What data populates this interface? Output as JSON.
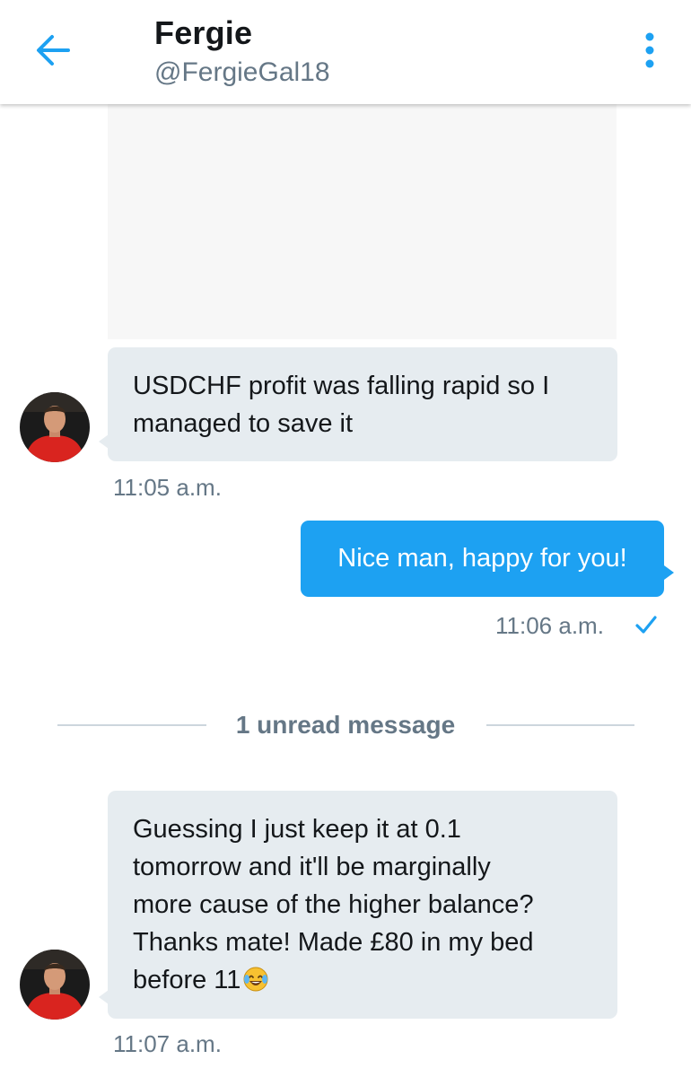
{
  "header": {
    "title": "Fergie",
    "handle": "@FergieGal18"
  },
  "messages": [
    {
      "direction": "incoming",
      "text": "USDCHF profit was falling rapid so I managed to save it",
      "time": "11:05 a.m."
    },
    {
      "direction": "outgoing",
      "text": "Nice man, happy for you!",
      "time": "11:06 a.m.",
      "status": "sent-checkmark"
    },
    {
      "direction": "incoming",
      "lines": [
        "Guessing I just keep it at 0.1",
        "tomorrow and it'll be marginally",
        "more cause of the higher balance?",
        "Thanks mate! Made £80 in my bed",
        "before 11"
      ],
      "emoji": "face-with-tears-of-joy",
      "time": "11:07 a.m."
    }
  ],
  "unread_divider": "1 unread message",
  "colors": {
    "accent": "#1da1f2",
    "incoming_bubble": "#e6ecf0",
    "secondary_text": "#657786",
    "primary_text": "#14171a"
  },
  "icons": {
    "back": "arrow-left-icon",
    "menu": "more-vertical-icon",
    "read_receipt": "checkmark-icon"
  }
}
